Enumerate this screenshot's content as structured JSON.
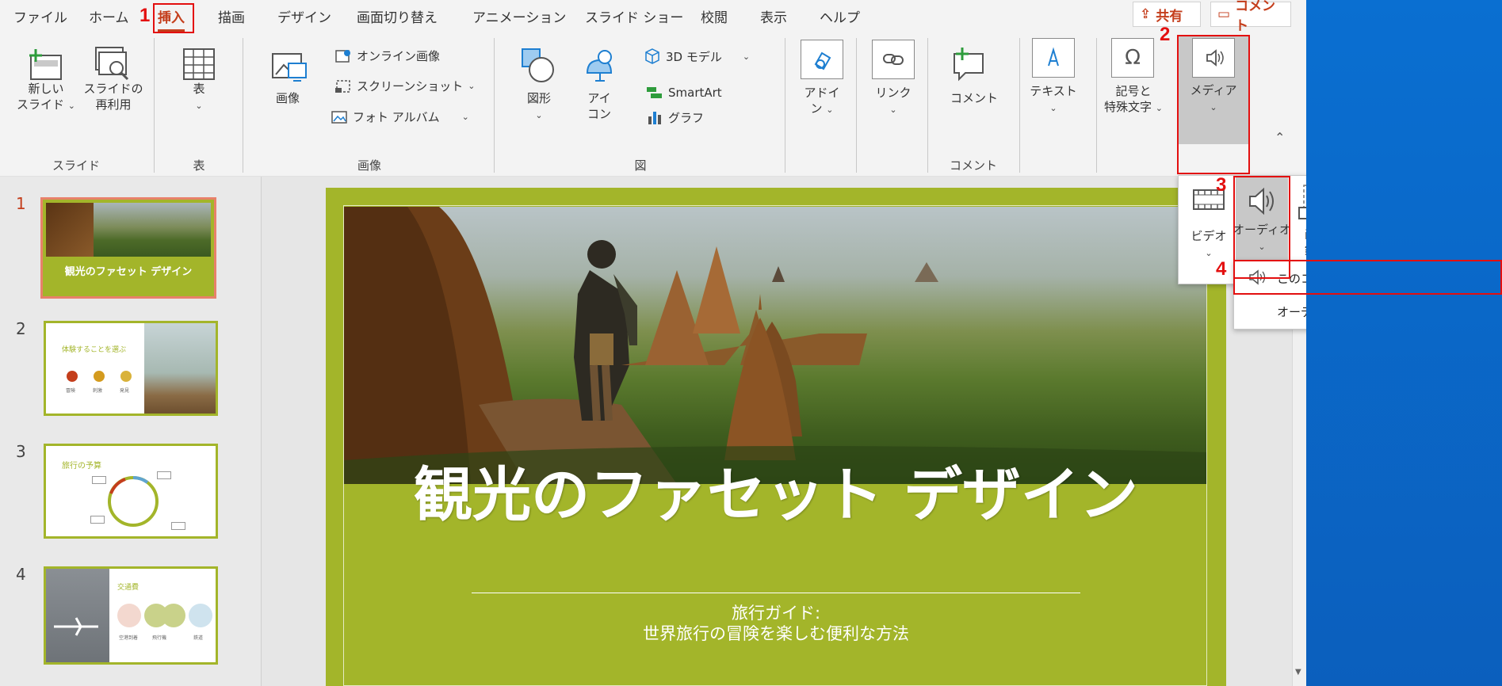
{
  "tabs": [
    "ファイル",
    "ホーム",
    "挿入",
    "描画",
    "デザイン",
    "画面切り替え",
    "アニメーション",
    "スライド ショー",
    "校閲",
    "表示",
    "ヘルプ"
  ],
  "share_label": "共有",
  "comment_label": "コメント",
  "steps": [
    "1",
    "2",
    "3",
    "4"
  ],
  "ribbon": {
    "groups": {
      "slides": "スライド",
      "table": "表",
      "images": "画像",
      "illustrations": "図",
      "comments": "コメント"
    },
    "new_slide": [
      "新しい",
      "スライド"
    ],
    "reuse_slide": [
      "スライドの",
      "再利用"
    ],
    "table": "表",
    "picture": "画像",
    "online_pictures": "オンライン画像",
    "screenshot": "スクリーンショット",
    "photo_album": "フォト アルバム",
    "shapes": "図形",
    "icons": [
      "アイ",
      "コン"
    ],
    "models_3d": "3D モデル",
    "smartart": "SmartArt",
    "chart": "グラフ",
    "addins": [
      "アドイ",
      "ン"
    ],
    "link": "リンク",
    "comment": "コメント",
    "text": "テキスト",
    "symbols": [
      "記号と",
      "特殊文字"
    ],
    "media": "メディア"
  },
  "media_menu": {
    "video": "ビデオ",
    "audio": "オーディオ",
    "screen_record": [
      "画面",
      "録画"
    ]
  },
  "audio_menu": {
    "from_computer": "このコンピューター上のオーディオ(P)...",
    "record": "オーディオの録音(R)..."
  },
  "thumbnails": [
    {
      "num": "1",
      "title": "観光のファセット デザイン"
    },
    {
      "num": "2",
      "title": "体験することを選ぶ",
      "labels": [
        "冒険",
        "刺激",
        "発見"
      ]
    },
    {
      "num": "3",
      "title": "旅行の予算"
    },
    {
      "num": "4",
      "title": "交通費",
      "labels": [
        "空港到着",
        "飛行機",
        "鉄道"
      ]
    }
  ],
  "slide": {
    "title": "観光のファセット デザイン",
    "subtitle_line1": "旅行ガイド:",
    "subtitle_line2": "世界旅行の冒険を楽しむ便利な方法"
  },
  "colors": {
    "accent": "#c43e1c",
    "slide_green": "#a3b52a",
    "highlight": "#e30f0f"
  }
}
